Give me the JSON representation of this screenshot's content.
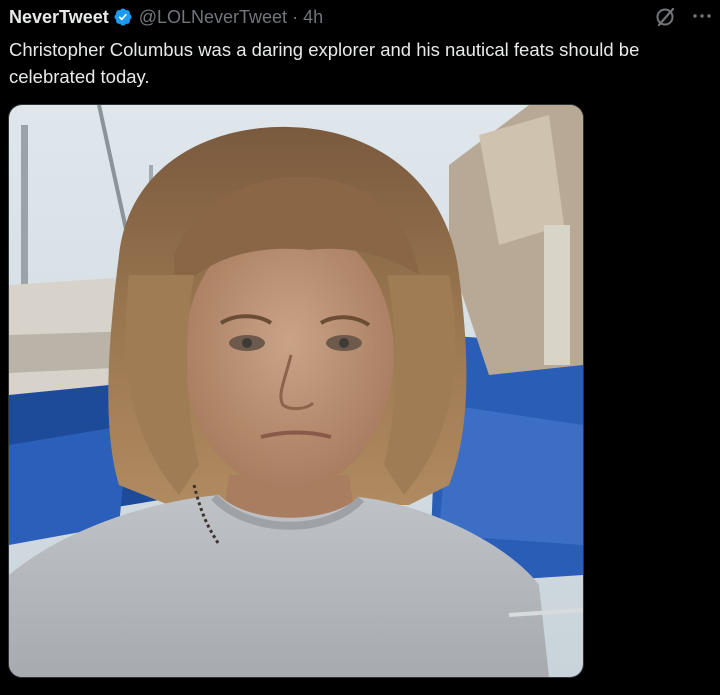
{
  "tweet": {
    "display_name": "NeverTweet",
    "handle": "@LOLNeverTweet",
    "separator": "·",
    "time": "4h",
    "text": "Christopher Columbus was a daring explorer and his nautical feats should be celebrated today.",
    "icons": {
      "verified": "verified-badge-icon",
      "grok": "grok-icon",
      "more": "more-options-icon"
    },
    "media": {
      "kind": "photo"
    }
  },
  "colors": {
    "background": "#000000",
    "text": "#e7e9ea",
    "secondary": "#71767b",
    "verified": "#1d9bf0"
  }
}
